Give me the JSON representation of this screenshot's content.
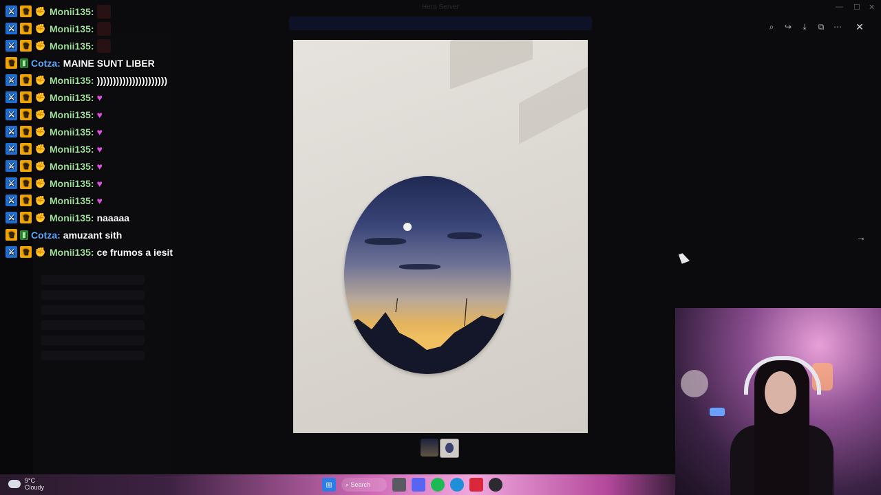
{
  "window": {
    "title": "Hera Server",
    "minimize": "—",
    "maximize": "☐",
    "close": "✕"
  },
  "viewer_toolbar": {
    "zoom_icon": "⌕",
    "share_icon": "↪",
    "download_icon": "⤓",
    "open_icon": "⧉",
    "more_icon": "⋯",
    "close_icon": "✕",
    "next_icon": "→"
  },
  "chat": {
    "messages": [
      {
        "user": "Monii135:",
        "name_color": "green",
        "text": "",
        "kind": "emote"
      },
      {
        "user": "Monii135:",
        "name_color": "green",
        "text": "",
        "kind": "emote"
      },
      {
        "user": "Monii135:",
        "name_color": "green",
        "text": "",
        "kind": "emote"
      },
      {
        "user": "Cotza:",
        "name_color": "blue",
        "text": "MAINE SUNT LIBER",
        "kind": "text"
      },
      {
        "user": "Monii135:",
        "name_color": "green",
        "text": "))))))))))))))))))))))",
        "kind": "text"
      },
      {
        "user": "Monii135:",
        "name_color": "green",
        "text": "",
        "kind": "heart"
      },
      {
        "user": "Monii135:",
        "name_color": "green",
        "text": "",
        "kind": "heart"
      },
      {
        "user": "Monii135:",
        "name_color": "green",
        "text": "",
        "kind": "heart"
      },
      {
        "user": "Monii135:",
        "name_color": "green",
        "text": "",
        "kind": "heart"
      },
      {
        "user": "Monii135:",
        "name_color": "green",
        "text": "",
        "kind": "heart"
      },
      {
        "user": "Monii135:",
        "name_color": "green",
        "text": "",
        "kind": "heart"
      },
      {
        "user": "Monii135:",
        "name_color": "green",
        "text": "",
        "kind": "heart"
      },
      {
        "user": "Monii135:",
        "name_color": "green",
        "text": "naaaaa",
        "kind": "text"
      },
      {
        "user": "Cotza:",
        "name_color": "blue",
        "text": "amuzant sith",
        "kind": "text"
      },
      {
        "user": "Monii135:",
        "name_color": "green",
        "text": "ce frumos a iesit",
        "kind": "text"
      }
    ]
  },
  "taskbar": {
    "weather_temp": "9°C",
    "weather_desc": "Cloudy",
    "search_label": "Search"
  },
  "colors": {
    "green_name": "#9fe29a",
    "blue_name": "#5aa8ff",
    "heart": "#e04fe0"
  }
}
